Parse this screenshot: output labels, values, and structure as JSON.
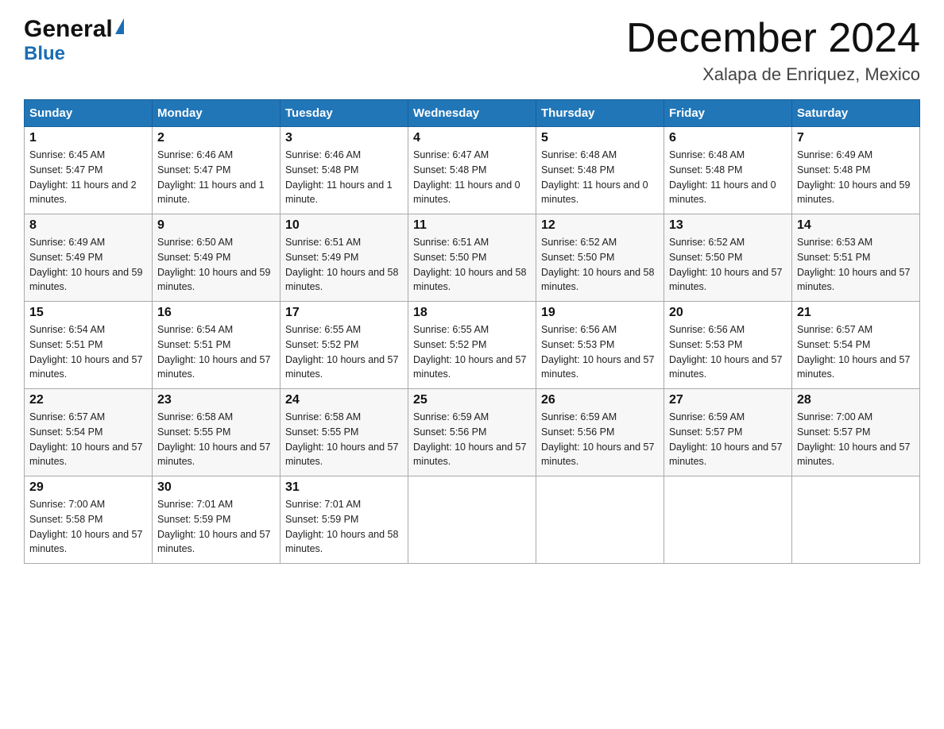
{
  "header": {
    "logo_general": "General",
    "logo_blue": "Blue",
    "month_title": "December 2024",
    "location": "Xalapa de Enriquez, Mexico"
  },
  "days_of_week": [
    "Sunday",
    "Monday",
    "Tuesday",
    "Wednesday",
    "Thursday",
    "Friday",
    "Saturday"
  ],
  "weeks": [
    [
      {
        "day": "1",
        "sunrise": "6:45 AM",
        "sunset": "5:47 PM",
        "daylight": "11 hours and 2 minutes."
      },
      {
        "day": "2",
        "sunrise": "6:46 AM",
        "sunset": "5:47 PM",
        "daylight": "11 hours and 1 minute."
      },
      {
        "day": "3",
        "sunrise": "6:46 AM",
        "sunset": "5:48 PM",
        "daylight": "11 hours and 1 minute."
      },
      {
        "day": "4",
        "sunrise": "6:47 AM",
        "sunset": "5:48 PM",
        "daylight": "11 hours and 0 minutes."
      },
      {
        "day": "5",
        "sunrise": "6:48 AM",
        "sunset": "5:48 PM",
        "daylight": "11 hours and 0 minutes."
      },
      {
        "day": "6",
        "sunrise": "6:48 AM",
        "sunset": "5:48 PM",
        "daylight": "11 hours and 0 minutes."
      },
      {
        "day": "7",
        "sunrise": "6:49 AM",
        "sunset": "5:48 PM",
        "daylight": "10 hours and 59 minutes."
      }
    ],
    [
      {
        "day": "8",
        "sunrise": "6:49 AM",
        "sunset": "5:49 PM",
        "daylight": "10 hours and 59 minutes."
      },
      {
        "day": "9",
        "sunrise": "6:50 AM",
        "sunset": "5:49 PM",
        "daylight": "10 hours and 59 minutes."
      },
      {
        "day": "10",
        "sunrise": "6:51 AM",
        "sunset": "5:49 PM",
        "daylight": "10 hours and 58 minutes."
      },
      {
        "day": "11",
        "sunrise": "6:51 AM",
        "sunset": "5:50 PM",
        "daylight": "10 hours and 58 minutes."
      },
      {
        "day": "12",
        "sunrise": "6:52 AM",
        "sunset": "5:50 PM",
        "daylight": "10 hours and 58 minutes."
      },
      {
        "day": "13",
        "sunrise": "6:52 AM",
        "sunset": "5:50 PM",
        "daylight": "10 hours and 57 minutes."
      },
      {
        "day": "14",
        "sunrise": "6:53 AM",
        "sunset": "5:51 PM",
        "daylight": "10 hours and 57 minutes."
      }
    ],
    [
      {
        "day": "15",
        "sunrise": "6:54 AM",
        "sunset": "5:51 PM",
        "daylight": "10 hours and 57 minutes."
      },
      {
        "day": "16",
        "sunrise": "6:54 AM",
        "sunset": "5:51 PM",
        "daylight": "10 hours and 57 minutes."
      },
      {
        "day": "17",
        "sunrise": "6:55 AM",
        "sunset": "5:52 PM",
        "daylight": "10 hours and 57 minutes."
      },
      {
        "day": "18",
        "sunrise": "6:55 AM",
        "sunset": "5:52 PM",
        "daylight": "10 hours and 57 minutes."
      },
      {
        "day": "19",
        "sunrise": "6:56 AM",
        "sunset": "5:53 PM",
        "daylight": "10 hours and 57 minutes."
      },
      {
        "day": "20",
        "sunrise": "6:56 AM",
        "sunset": "5:53 PM",
        "daylight": "10 hours and 57 minutes."
      },
      {
        "day": "21",
        "sunrise": "6:57 AM",
        "sunset": "5:54 PM",
        "daylight": "10 hours and 57 minutes."
      }
    ],
    [
      {
        "day": "22",
        "sunrise": "6:57 AM",
        "sunset": "5:54 PM",
        "daylight": "10 hours and 57 minutes."
      },
      {
        "day": "23",
        "sunrise": "6:58 AM",
        "sunset": "5:55 PM",
        "daylight": "10 hours and 57 minutes."
      },
      {
        "day": "24",
        "sunrise": "6:58 AM",
        "sunset": "5:55 PM",
        "daylight": "10 hours and 57 minutes."
      },
      {
        "day": "25",
        "sunrise": "6:59 AM",
        "sunset": "5:56 PM",
        "daylight": "10 hours and 57 minutes."
      },
      {
        "day": "26",
        "sunrise": "6:59 AM",
        "sunset": "5:56 PM",
        "daylight": "10 hours and 57 minutes."
      },
      {
        "day": "27",
        "sunrise": "6:59 AM",
        "sunset": "5:57 PM",
        "daylight": "10 hours and 57 minutes."
      },
      {
        "day": "28",
        "sunrise": "7:00 AM",
        "sunset": "5:57 PM",
        "daylight": "10 hours and 57 minutes."
      }
    ],
    [
      {
        "day": "29",
        "sunrise": "7:00 AM",
        "sunset": "5:58 PM",
        "daylight": "10 hours and 57 minutes."
      },
      {
        "day": "30",
        "sunrise": "7:01 AM",
        "sunset": "5:59 PM",
        "daylight": "10 hours and 57 minutes."
      },
      {
        "day": "31",
        "sunrise": "7:01 AM",
        "sunset": "5:59 PM",
        "daylight": "10 hours and 58 minutes."
      },
      null,
      null,
      null,
      null
    ]
  ]
}
